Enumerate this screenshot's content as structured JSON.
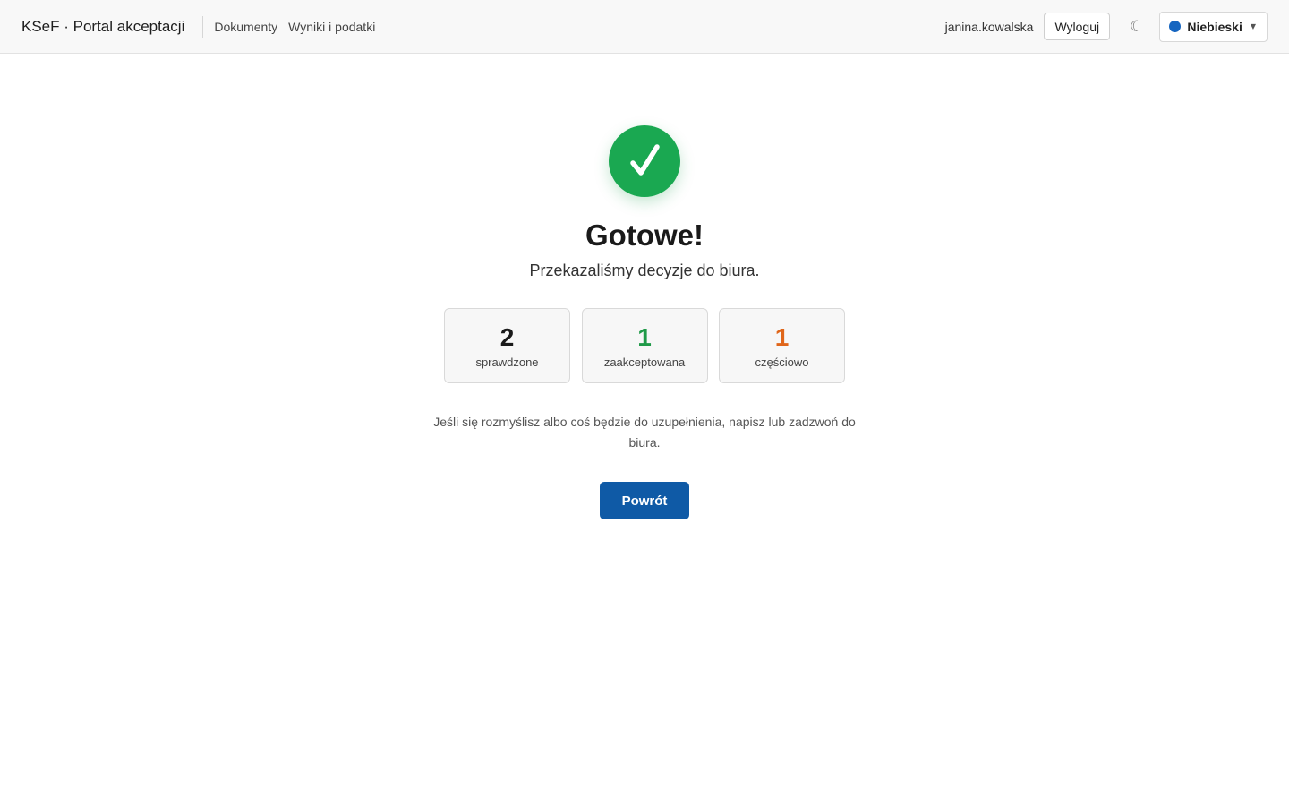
{
  "header": {
    "brand": "KSeF · Portal akceptacji",
    "nav": [
      {
        "label": "Dokumenty"
      },
      {
        "label": "Wyniki i podatki"
      }
    ],
    "username": "janina.kowalska",
    "logout_label": "Wyloguj",
    "theme_toggle_icon": "moon-icon",
    "theme": {
      "label": "Niebieski",
      "color": "#1565c0"
    }
  },
  "confirmation": {
    "icon": "checkmark-icon",
    "icon_color": "#1aa851",
    "title": "Gotowe!",
    "subtitle": "Przekazaliśmy decyzje do biura.",
    "stats": [
      {
        "value": "2",
        "label": "sprawdzone",
        "color": "#1a1a1a"
      },
      {
        "value": "1",
        "label": "zaakceptowana",
        "color": "#1f9a48"
      },
      {
        "value": "1",
        "label": "częściowo",
        "color": "#e0661a"
      }
    ],
    "note": "Jeśli się rozmyślisz albo coś będzie do uzupełnienia, napisz lub zadzwoń do biura.",
    "back_label": "Powrót",
    "back_color": "#0f5aa6"
  }
}
